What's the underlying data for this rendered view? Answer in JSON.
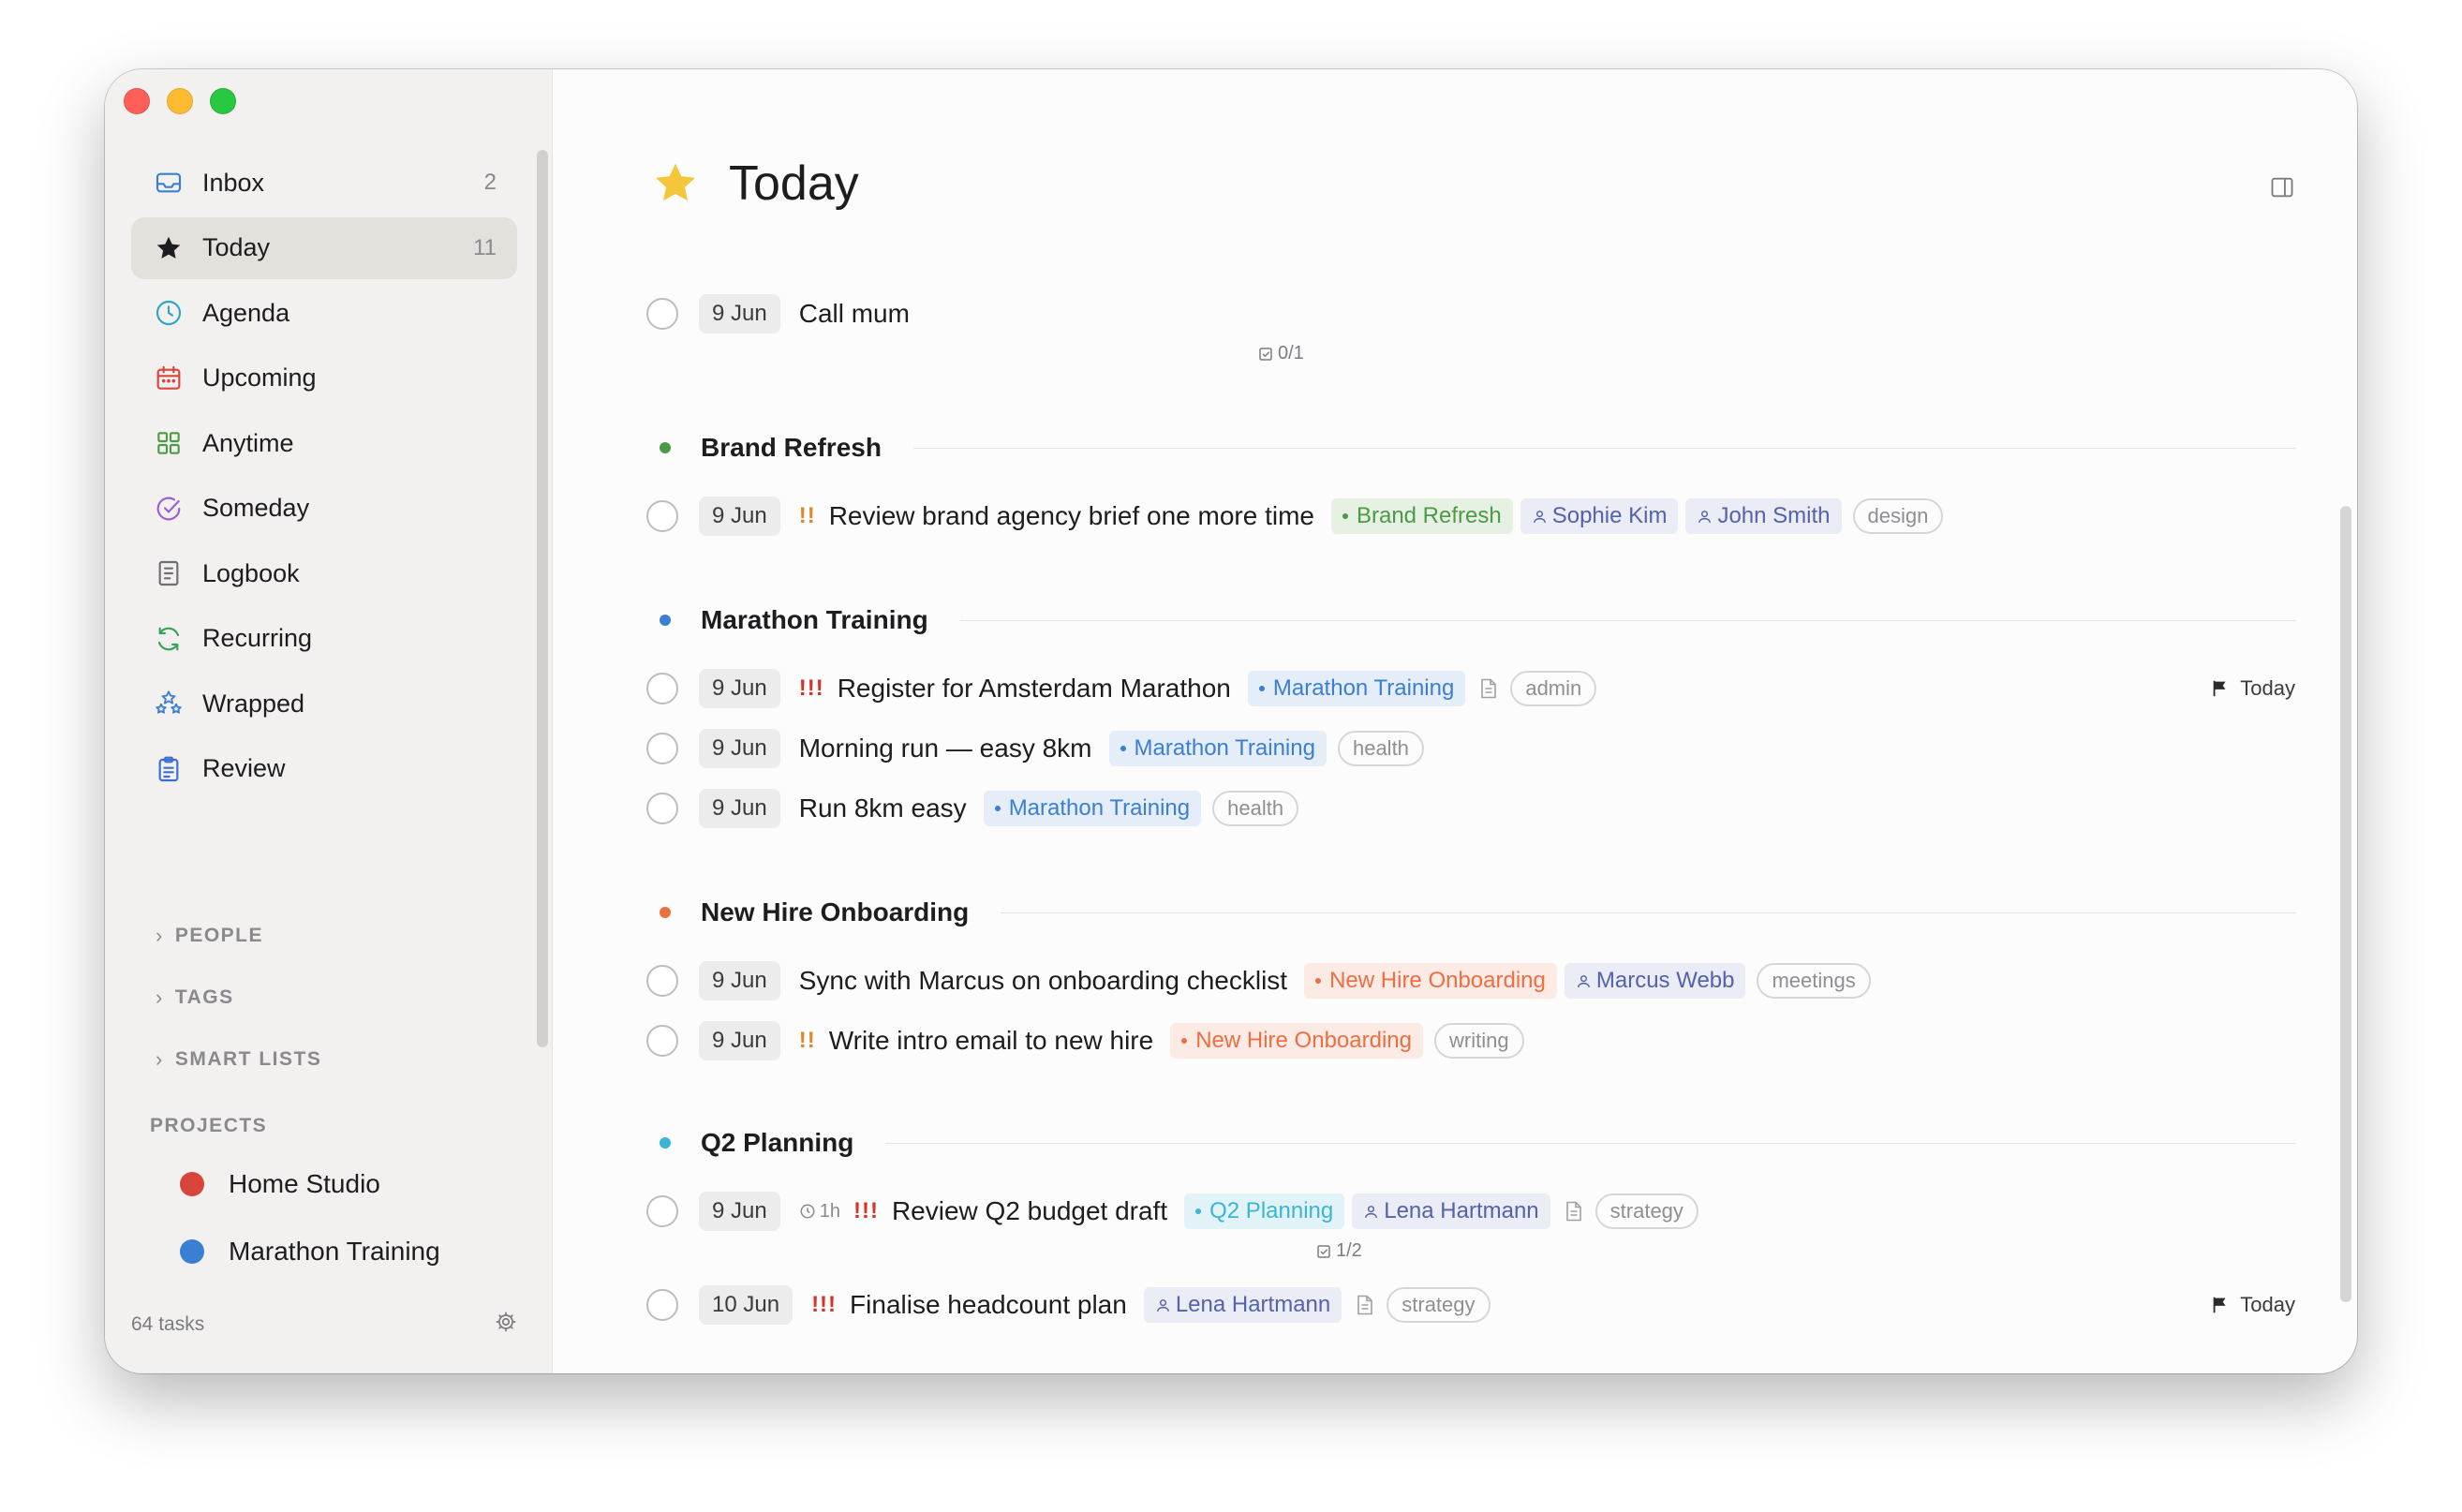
{
  "colors": {
    "accent_star": "#f4c63a",
    "brand_refresh": "#4b9a45",
    "marathon_training": "#3b7fd2",
    "new_hire_onboarding": "#ec6f44",
    "q2_planning": "#3ab5d4",
    "home_studio": "#d8453b",
    "priority_high": "#d4342b",
    "priority_medium": "#e0862d",
    "person": "#5462aa"
  },
  "sidebar": {
    "nav": [
      {
        "label": "Inbox",
        "count": "2",
        "icon": "inbox-icon"
      },
      {
        "label": "Today",
        "count": "11",
        "icon": "star-icon"
      },
      {
        "label": "Agenda",
        "count": "",
        "icon": "clock-icon"
      },
      {
        "label": "Upcoming",
        "count": "",
        "icon": "calendar-icon"
      },
      {
        "label": "Anytime",
        "count": "",
        "icon": "grid-icon"
      },
      {
        "label": "Someday",
        "count": "",
        "icon": "someday-icon"
      },
      {
        "label": "Logbook",
        "count": "",
        "icon": "logbook-icon"
      },
      {
        "label": "Recurring",
        "count": "",
        "icon": "recurring-icon"
      },
      {
        "label": "Wrapped",
        "count": "",
        "icon": "stars-icon"
      },
      {
        "label": "Review",
        "count": "",
        "icon": "clipboard-icon"
      }
    ],
    "sections": {
      "people": "PEOPLE",
      "tags": "TAGS",
      "smart_lists": "SMART LISTS"
    },
    "projects_heading": "PROJECTS",
    "projects": [
      {
        "name": "Home Studio"
      },
      {
        "name": "Marathon Training"
      }
    ],
    "footer": {
      "task_count": "64 tasks"
    }
  },
  "main": {
    "title": "Today",
    "loose_task": {
      "date": "9 Jun",
      "title": "Call mum",
      "checklist": "0/1"
    },
    "groups": [
      {
        "name": "Brand Refresh",
        "tasks": [
          {
            "date": "9 Jun",
            "priority": "!!",
            "title": "Review brand agency brief one more time",
            "project": "Brand Refresh",
            "people": [
              "Sophie Kim",
              "John Smith"
            ],
            "tags": [
              "design"
            ]
          }
        ]
      },
      {
        "name": "Marathon Training",
        "tasks": [
          {
            "date": "9 Jun",
            "priority": "!!!",
            "title": "Register for Amsterdam Marathon",
            "project": "Marathon Training",
            "tags": [
              "admin"
            ],
            "deadline": "Today"
          },
          {
            "date": "9 Jun",
            "title": "Morning run — easy 8km",
            "project": "Marathon Training",
            "tags": [
              "health"
            ]
          },
          {
            "date": "9 Jun",
            "title": "Run 8km easy",
            "project": "Marathon Training",
            "tags": [
              "health"
            ]
          }
        ]
      },
      {
        "name": "New Hire Onboarding",
        "tasks": [
          {
            "date": "9 Jun",
            "title": "Sync with Marcus on onboarding checklist",
            "project": "New Hire Onboarding",
            "people": [
              "Marcus Webb"
            ],
            "tags": [
              "meetings"
            ]
          },
          {
            "date": "9 Jun",
            "priority": "!!",
            "title": "Write intro email to new hire",
            "project": "New Hire Onboarding",
            "tags": [
              "writing"
            ]
          }
        ]
      },
      {
        "name": "Q2 Planning",
        "tasks": [
          {
            "date": "9 Jun",
            "duration": "1h",
            "priority": "!!!",
            "title": "Review Q2 budget draft",
            "project": "Q2 Planning",
            "people": [
              "Lena Hartmann"
            ],
            "tags": [
              "strategy"
            ],
            "checklist": "1/2"
          },
          {
            "date": "10 Jun",
            "priority": "!!!",
            "title": "Finalise headcount plan",
            "people": [
              "Lena Hartmann"
            ],
            "tags": [
              "strategy"
            ],
            "deadline": "Today"
          }
        ]
      }
    ]
  }
}
